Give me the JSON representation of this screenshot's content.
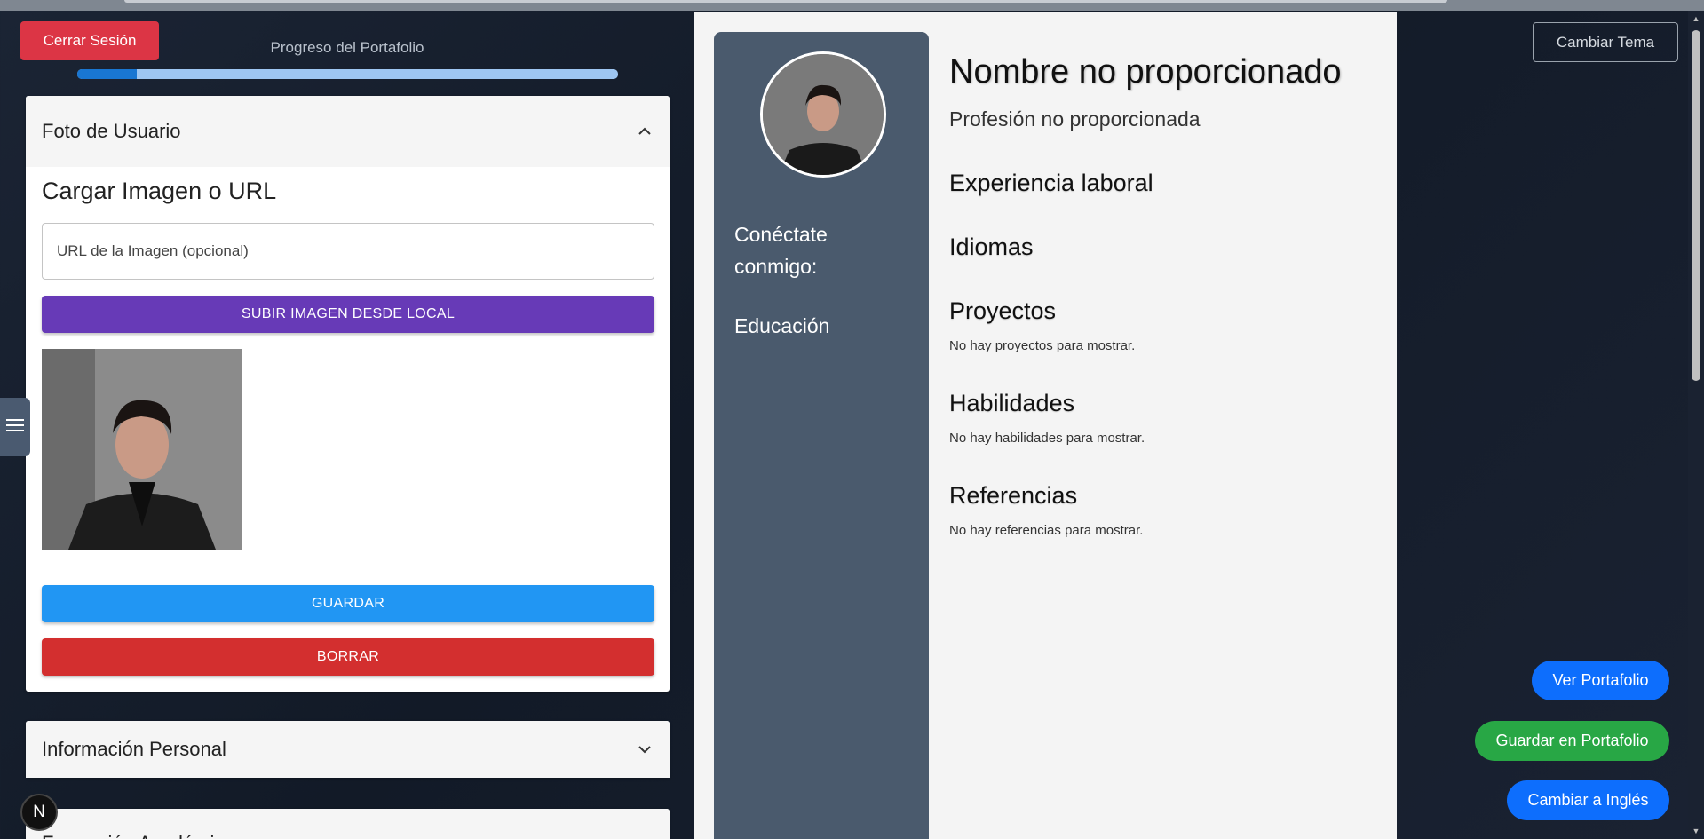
{
  "header": {
    "logout_label": "Cerrar Sesión",
    "progress_label": "Progreso del Portafolio",
    "progress_fraction": 0.11,
    "theme_label": "Cambiar Tema"
  },
  "editor": {
    "photo_panel": {
      "title": "Foto de Usuario",
      "section_title": "Cargar Imagen o URL",
      "url_placeholder": "URL de la Imagen (opcional)",
      "upload_label": "SUBIR IMAGEN DESDE LOCAL",
      "save_label": "GUARDAR",
      "delete_label": "BORRAR"
    },
    "personal_panel": {
      "title": "Información Personal"
    },
    "academic_panel": {
      "title": "Formación Académica"
    }
  },
  "preview": {
    "side": {
      "connect_label": "Conéctate conmigo:",
      "education_label": "Educación"
    },
    "name": "Nombre no proporcionado",
    "profession": "Profesión no proporcionada",
    "sections": {
      "experience": "Experiencia laboral",
      "languages": "Idiomas",
      "projects": {
        "title": "Proyectos",
        "empty": "No hay proyectos para mostrar."
      },
      "skills": {
        "title": "Habilidades",
        "empty": "No hay habilidades para mostrar."
      },
      "references": {
        "title": "Referencias",
        "empty": "No hay referencias para mostrar."
      }
    }
  },
  "actions": {
    "view_portfolio": "Ver Portafolio",
    "save_portfolio": "Guardar en Portafolio",
    "switch_english": "Cambiar a Inglés"
  },
  "badge": {
    "letter": "N"
  },
  "colors": {
    "danger": "#dc3545",
    "primary": "#2196f3",
    "purple": "#673ab7",
    "red": "#d32f2f",
    "sidebar": "#4a5a6d",
    "pill_blue": "#0d6efd",
    "pill_green": "#28a745"
  },
  "icons": {
    "collapse": "chevron-up-icon",
    "expand": "chevron-down-icon",
    "menu": "hamburger-menu-icon"
  }
}
